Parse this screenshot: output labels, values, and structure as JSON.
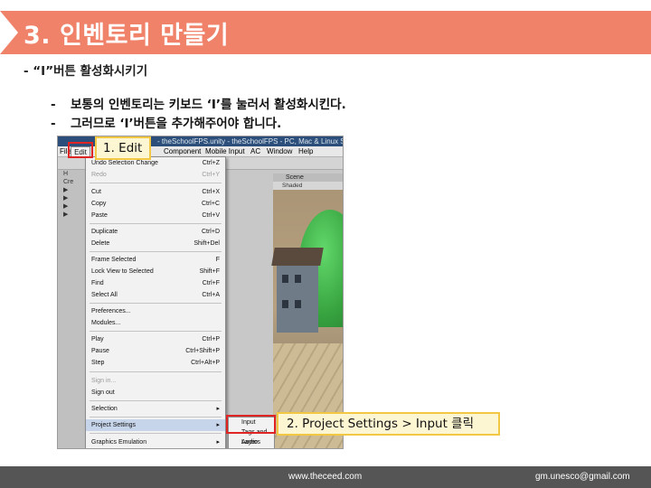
{
  "slide": {
    "title": "3. 인벤토리 만들기",
    "subheading": "- “I”버튼 활성화시키기",
    "bullets": [
      {
        "dash": "-",
        "text": "보통의 인벤토리는 키보드 ‘I’를 눌러서 활성화시킨다."
      },
      {
        "dash": "-",
        "text": "그러므로 ‘I’버튼을 추가해주어야 합니다."
      }
    ],
    "callouts": {
      "edit": "1. Edit",
      "input": "2. Project Settings > Input 클릭"
    },
    "footer": {
      "website": "www.theceed.com",
      "email": "gm.unesco@gmail.com"
    },
    "colors": {
      "title_bar": "#f0826a",
      "callout_bg": "#fdf6d3",
      "callout_border": "#f2c744",
      "highlight": "#e02424",
      "footer_bg": "#555555"
    }
  },
  "unity": {
    "window_title": "- theSchoolFPS.unity - theSchoolFPS - PC, Mac & Linux Standalo",
    "menubar": {
      "file": "File",
      "edit": "Edit",
      "component": "Component",
      "mobile_input": "Mobile Input",
      "ac": "AC",
      "window": "Window",
      "help": "Help"
    },
    "left_panel": [
      "H",
      "Cre",
      "▶",
      "▶",
      "▶",
      "▶"
    ],
    "scene_tab": "Scene",
    "scene_mode": "Shaded",
    "edit_menu": [
      {
        "label": "Undo Selection Change",
        "shortcut": "Ctrl+Z"
      },
      {
        "label": "Redo",
        "shortcut": "Ctrl+Y",
        "disabled": true
      },
      {
        "label": "Cut",
        "shortcut": "Ctrl+X"
      },
      {
        "label": "Copy",
        "shortcut": "Ctrl+C"
      },
      {
        "label": "Paste",
        "shortcut": "Ctrl+V"
      },
      {
        "label": "Duplicate",
        "shortcut": "Ctrl+D"
      },
      {
        "label": "Delete",
        "shortcut": "Shift+Del"
      },
      {
        "label": "Frame Selected",
        "shortcut": "F"
      },
      {
        "label": "Lock View to Selected",
        "shortcut": "Shift+F"
      },
      {
        "label": "Find",
        "shortcut": "Ctrl+F"
      },
      {
        "label": "Select All",
        "shortcut": "Ctrl+A"
      },
      {
        "label": "Preferences...",
        "shortcut": ""
      },
      {
        "label": "Modules...",
        "shortcut": ""
      },
      {
        "label": "Play",
        "shortcut": "Ctrl+P"
      },
      {
        "label": "Pause",
        "shortcut": "Ctrl+Shift+P"
      },
      {
        "label": "Step",
        "shortcut": "Ctrl+Alt+P"
      },
      {
        "label": "Sign in...",
        "shortcut": "",
        "disabled": true
      },
      {
        "label": "Sign out",
        "shortcut": ""
      },
      {
        "label": "Selection",
        "shortcut": "▸"
      },
      {
        "label": "Project Settings",
        "shortcut": "▸",
        "active": true
      },
      {
        "label": "Graphics Emulation",
        "shortcut": "▸"
      }
    ],
    "submenu": [
      "Input",
      "Tags and Layers",
      "Audio"
    ]
  }
}
